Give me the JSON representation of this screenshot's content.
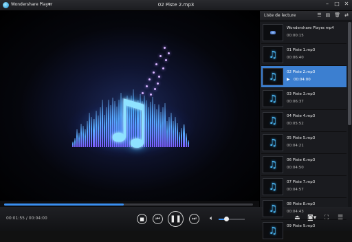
{
  "app": {
    "name": "Wondershare Player",
    "menu_icon": "triangle-down-icon"
  },
  "window": {
    "title": "02 Piste 2.mp3",
    "controls": [
      "minimize-icon",
      "maximize-icon",
      "close-icon"
    ]
  },
  "player": {
    "time_display": "00:01:55 / 00:04:00",
    "progress": 0.48,
    "volume": 0.28,
    "buttons": [
      "stop",
      "previous",
      "pause",
      "next"
    ]
  },
  "playlist": {
    "title": "Liste de lecture",
    "tools": [
      "list-view-icon",
      "playlist-icon",
      "delete-icon",
      "shuffle-icon"
    ],
    "items": [
      {
        "name": "Wondershare Player.mp4",
        "duration": "00:00:15",
        "type": "video",
        "active": false
      },
      {
        "name": "01 Piste 1.mp3",
        "duration": "00:06:40",
        "type": "audio",
        "active": false
      },
      {
        "name": "02 Piste 2.mp3",
        "duration": "00:04:00",
        "type": "audio",
        "active": true
      },
      {
        "name": "03 Piste 3.mp3",
        "duration": "00:06:37",
        "type": "audio",
        "active": false
      },
      {
        "name": "04 Piste 4.mp3",
        "duration": "00:05:52",
        "type": "audio",
        "active": false
      },
      {
        "name": "05 Piste 5.mp3",
        "duration": "00:04:21",
        "type": "audio",
        "active": false
      },
      {
        "name": "06 Piste 6.mp3",
        "duration": "00:04:50",
        "type": "audio",
        "active": false
      },
      {
        "name": "07 Piste 7.mp3",
        "duration": "00:04:57",
        "type": "audio",
        "active": false
      },
      {
        "name": "08 Piste 8.mp3",
        "duration": "00:04:43",
        "type": "audio",
        "active": false
      },
      {
        "name": "09 Piste 9.mp3",
        "duration": "",
        "type": "audio",
        "active": false
      }
    ]
  },
  "colors": {
    "accent": "#3c7fd0",
    "note_glow": "#39b7ff"
  }
}
